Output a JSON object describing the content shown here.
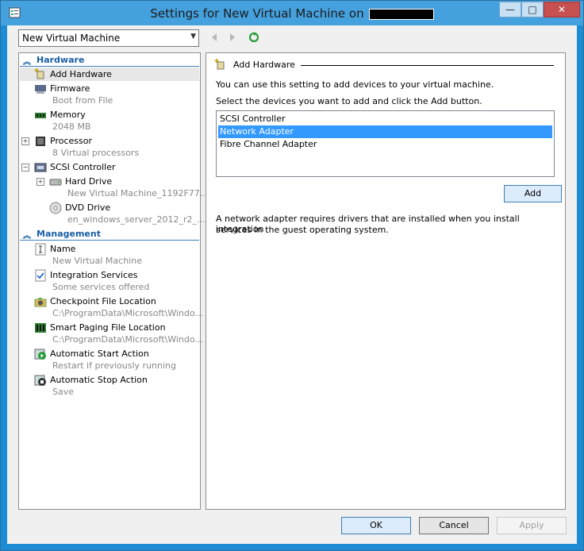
{
  "window": {
    "title": "Settings for New Virtual Machine on",
    "minimize": "—",
    "maximize": "□",
    "close": "✕"
  },
  "vm_selector": {
    "value": "New Virtual Machine"
  },
  "sidebar": {
    "hardware_header": "Hardware",
    "management_header": "Management",
    "hardware_items": [
      {
        "label": "Add Hardware",
        "sub": ""
      },
      {
        "label": "Firmware",
        "sub": "Boot from File"
      },
      {
        "label": "Memory",
        "sub": "2048 MB"
      },
      {
        "label": "Processor",
        "sub": "8 Virtual processors"
      },
      {
        "label": "SCSI Controller",
        "sub": ""
      },
      {
        "label": "Hard Drive",
        "sub": "New Virtual Machine_1192F77..."
      },
      {
        "label": "DVD Drive",
        "sub": "en_windows_server_2012_r2_..."
      }
    ],
    "management_items": [
      {
        "label": "Name",
        "sub": "New Virtual Machine"
      },
      {
        "label": "Integration Services",
        "sub": "Some services offered"
      },
      {
        "label": "Checkpoint File Location",
        "sub": "C:\\ProgramData\\Microsoft\\Windo..."
      },
      {
        "label": "Smart Paging File Location",
        "sub": "C:\\ProgramData\\Microsoft\\Windo..."
      },
      {
        "label": "Automatic Start Action",
        "sub": "Restart if previously running"
      },
      {
        "label": "Automatic Stop Action",
        "sub": "Save"
      }
    ]
  },
  "panel": {
    "title": "Add Hardware",
    "intro": "You can use this setting to add devices to your virtual machine.",
    "instruction": "Select the devices you want to add and click the Add button.",
    "devices": [
      "SCSI Controller",
      "Network Adapter",
      "Fibre Channel Adapter"
    ],
    "selected_device": "Network Adapter",
    "add_label": "Add",
    "note_line1": "A network adapter requires drivers that are installed when you install integration",
    "note_line2": "services in the guest operating system."
  },
  "footer": {
    "ok": "OK",
    "cancel": "Cancel",
    "apply": "Apply"
  },
  "colors": {
    "accent": "#1e8bd5",
    "section": "#1a5ea8",
    "selection": "#3399ff"
  }
}
